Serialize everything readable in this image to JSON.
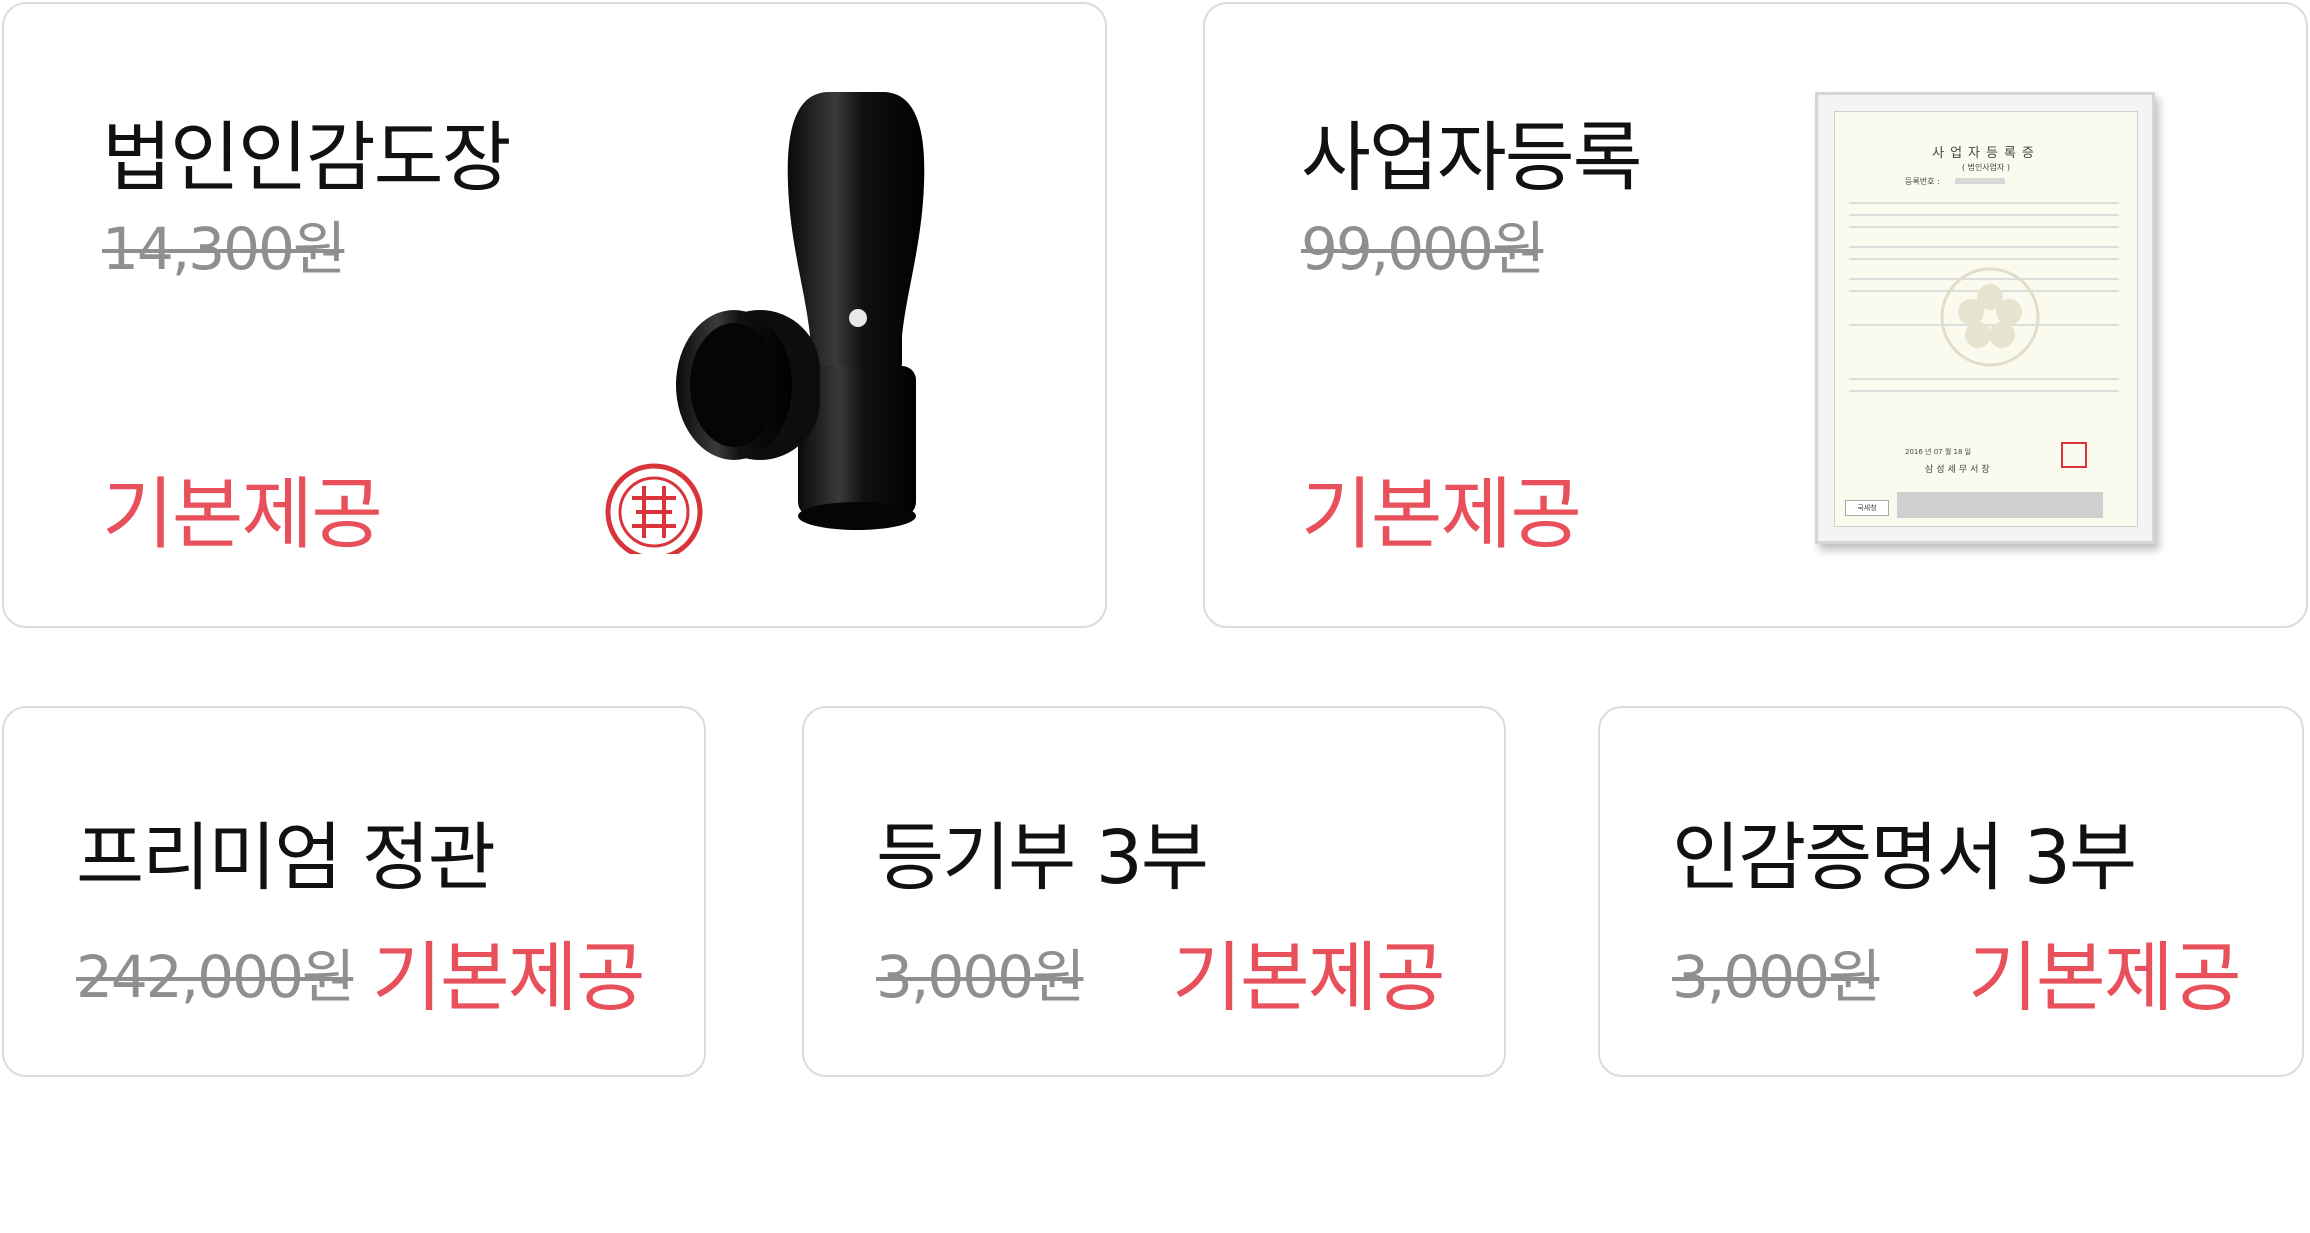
{
  "cards": [
    {
      "title": "법인인감도장",
      "original_price": "14,300원",
      "badge": "기본제공",
      "image": "corporate-seal-stamp-image"
    },
    {
      "title": "사업자등록",
      "original_price": "99,000원",
      "badge": "기본제공",
      "image": "business-registration-certificate-image"
    },
    {
      "title": "프리미엄 정관",
      "original_price": "242,000원",
      "badge": "기본제공"
    },
    {
      "title": "등기부 3부",
      "original_price": "3,000원",
      "badge": "기본제공"
    },
    {
      "title": "인감증명서 3부",
      "original_price": "3,000원",
      "badge": "기본제공"
    }
  ],
  "certificate": {
    "heading": "사업자등록증",
    "subheading": "( 법인사업자 )",
    "reg_label": "등록번호 :",
    "date_line": "2016 년 07 월 18 일",
    "office": "삼성세무서장",
    "agency": "국세청"
  },
  "colors": {
    "accent": "#e8505b",
    "strike": "#8f8f8f",
    "border": "#dcdcdc"
  }
}
